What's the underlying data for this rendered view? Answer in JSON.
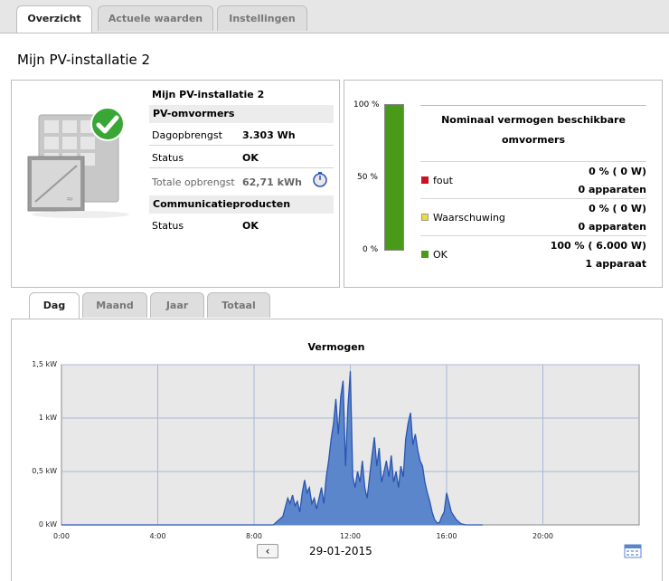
{
  "tabs": [
    {
      "label": "Overzicht",
      "active": true
    },
    {
      "label": "Actuele waarden",
      "active": false
    },
    {
      "label": "Instellingen",
      "active": false
    }
  ],
  "page_title": "Mijn PV-installatie 2",
  "plant": {
    "name": "Mijn PV-installatie 2",
    "inverters_header": "PV-omvormers",
    "rows": [
      {
        "label": "Dagopbrengst",
        "value": "3.303 Wh"
      },
      {
        "label": "Status",
        "value": "OK"
      },
      {
        "label": "Totale opbrengst",
        "value": "62,71 kWh"
      }
    ],
    "comm_header": "Communicatieproducten",
    "comm_rows": [
      {
        "label": "Status",
        "value": "OK"
      }
    ]
  },
  "nominal": {
    "title_line1": "Nominaal vermogen beschikbare",
    "title_line2": "omvormers",
    "scale": [
      "100 %",
      "50 %",
      "0 %"
    ],
    "items": [
      {
        "label": "fout",
        "color": "#cc1122",
        "pct": "0 %  ( 0 W)",
        "count": "0 apparaten"
      },
      {
        "label": "Waarschuwing",
        "color": "#e8df3a",
        "pct": "0 %  ( 0 W)",
        "count": "0 apparaten"
      },
      {
        "label": "OK",
        "color": "#4a9a1a",
        "pct": "100 %  ( 6.000 W)",
        "count": "1 apparaat"
      }
    ],
    "bar_fraction": 1.0,
    "bar_color": "#4a9a1a"
  },
  "period_tabs": [
    {
      "label": "Dag",
      "active": true
    },
    {
      "label": "Maand",
      "active": false
    },
    {
      "label": "Jaar",
      "active": false
    },
    {
      "label": "Totaal",
      "active": false
    }
  ],
  "date_label": "29-01-2015",
  "chart_data": {
    "type": "area",
    "title": "Vermogen",
    "x_ticks": [
      "0:00",
      "4:00",
      "8:00",
      "12:00",
      "16:00",
      "20:00"
    ],
    "y_ticks": [
      "0 kW",
      "0,5 kW",
      "1 kW",
      "1,5 kW"
    ],
    "xlim": [
      0,
      24
    ],
    "ylim": [
      0,
      1.5
    ],
    "fill_color": "#5b86cc",
    "line_color": "#2a55b0",
    "x": [
      0,
      8.8,
      9.2,
      9.4,
      9.5,
      9.6,
      9.7,
      9.8,
      9.9,
      10.0,
      10.1,
      10.2,
      10.3,
      10.4,
      10.5,
      10.6,
      10.7,
      10.8,
      10.9,
      11.0,
      11.1,
      11.2,
      11.3,
      11.4,
      11.5,
      11.6,
      11.7,
      11.8,
      11.9,
      12.0,
      12.1,
      12.2,
      12.3,
      12.4,
      12.5,
      12.6,
      12.7,
      12.8,
      12.9,
      13.0,
      13.1,
      13.2,
      13.3,
      13.4,
      13.5,
      13.6,
      13.7,
      13.8,
      13.9,
      14.0,
      14.1,
      14.2,
      14.3,
      14.4,
      14.5,
      14.6,
      14.7,
      14.8,
      14.9,
      15.0,
      15.1,
      15.2,
      15.3,
      15.4,
      15.5,
      15.6,
      15.7,
      15.8,
      15.9,
      16.0,
      16.2,
      16.4,
      16.6,
      16.8,
      17.0,
      17.2,
      17.5
    ],
    "y": [
      0,
      0,
      0.08,
      0.25,
      0.2,
      0.28,
      0.18,
      0.22,
      0.12,
      0.3,
      0.42,
      0.3,
      0.35,
      0.2,
      0.25,
      0.15,
      0.25,
      0.35,
      0.2,
      0.45,
      0.6,
      0.8,
      0.95,
      1.18,
      0.85,
      1.2,
      1.35,
      0.55,
      1.1,
      1.44,
      0.45,
      0.35,
      0.5,
      0.4,
      0.6,
      0.35,
      0.25,
      0.45,
      0.65,
      0.82,
      0.55,
      0.72,
      0.4,
      0.5,
      0.6,
      0.45,
      0.65,
      0.4,
      0.5,
      0.35,
      0.55,
      0.45,
      0.8,
      0.95,
      1.05,
      0.75,
      0.85,
      0.7,
      0.6,
      0.55,
      0.4,
      0.3,
      0.22,
      0.12,
      0.05,
      0.02,
      0.02,
      0.08,
      0.12,
      0.3,
      0.12,
      0.05,
      0.01,
      0.0,
      0.0,
      0.0,
      0.0
    ]
  }
}
